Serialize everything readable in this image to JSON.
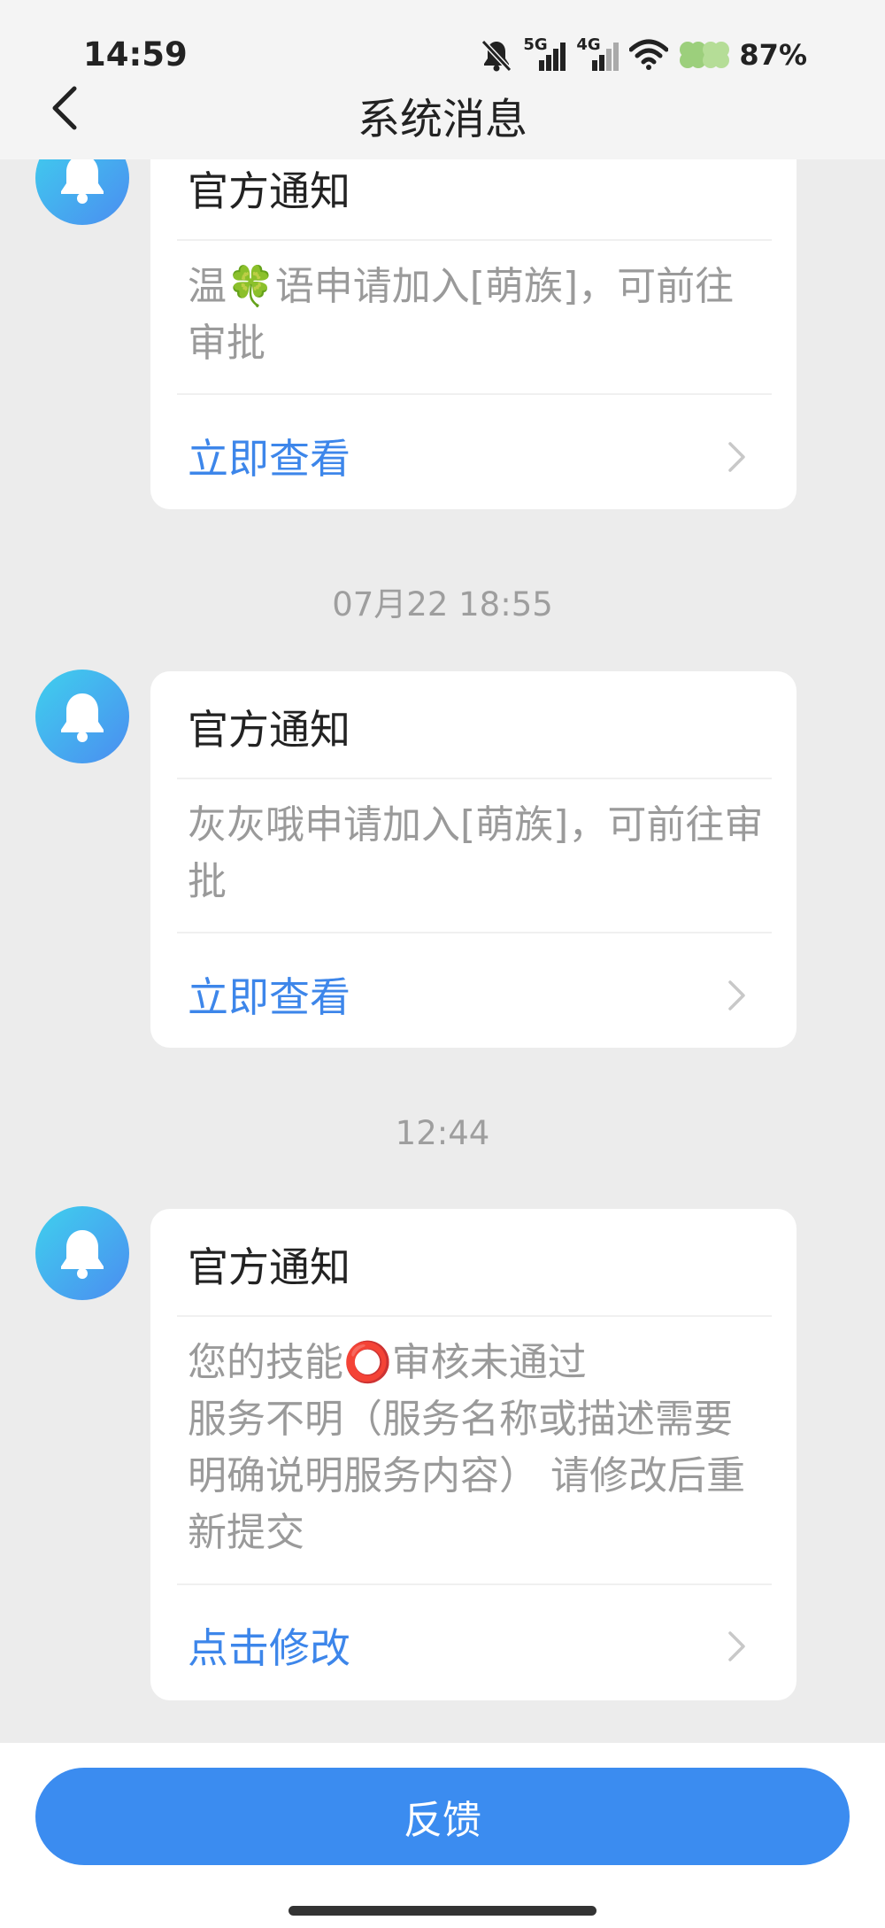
{
  "status_bar": {
    "time": "14:59",
    "network_1": "5G",
    "network_2": "4G",
    "battery": "87%",
    "icons": [
      "bell-muted-icon",
      "signal-5g-icon",
      "signal-4g-icon",
      "wifi-icon",
      "clover-icon",
      "battery-text"
    ]
  },
  "header": {
    "title": "系统消息",
    "back_icon": "chevron-left-icon"
  },
  "messages": [
    {
      "title": "官方通知",
      "body": "温🍀语申请加入[萌族]，可前往审批",
      "action": "立即查看"
    },
    {
      "timestamp": "07月22 18:55",
      "title": "官方通知",
      "body": "灰灰哦申请加入[萌族]，可前往审批",
      "action": "立即查看"
    },
    {
      "timestamp": "12:44",
      "title": "官方通知",
      "body_line1": "您的技能⭕审核未通过",
      "body_line2": "服务不明（服务名称或描述需要明确说明服务内容） 请修改后重新提交",
      "action": "点击修改"
    }
  ],
  "footer": {
    "feedback_label": "反馈"
  },
  "colors": {
    "accent": "#3b8cf0",
    "link": "#3d86ea",
    "background": "#ececec",
    "avatar_gradient": [
      "#3fd0ee",
      "#4b8df0"
    ]
  }
}
